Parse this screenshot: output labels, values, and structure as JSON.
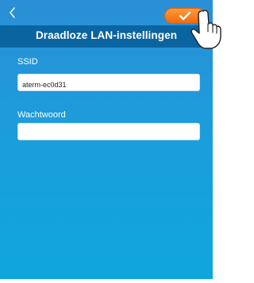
{
  "nav": {
    "back_icon": "chevron-left-icon",
    "confirm_icon": "checkmark-icon"
  },
  "header": {
    "title": "Draadloze LAN-instellingen"
  },
  "form": {
    "ssid_label": "SSID",
    "ssid_value": "aterm-ec0d31",
    "password_label": "Wachtwoord",
    "password_value": ""
  },
  "colors": {
    "background_top": "#2a8fd6",
    "background_bottom": "#0fa6dd",
    "titlebar": "#0a64a0",
    "confirm_button": "#f27a1a"
  }
}
